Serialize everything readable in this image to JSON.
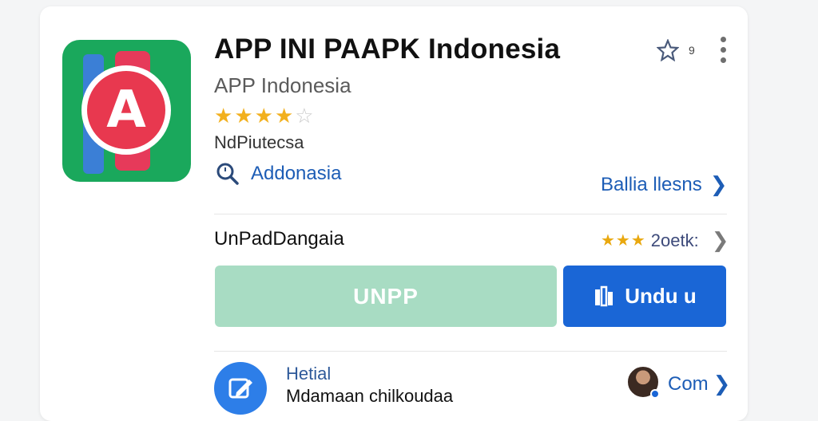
{
  "app": {
    "title": "APP INI PAAPK Indonesia",
    "developer": "APP Indonesia",
    "rating_stars": 4,
    "rating_max": 5,
    "category": "NdPiutecsa",
    "search_label": "Addonasia",
    "right_link": "Ballia llesns",
    "wishlist_count": "9",
    "icon_letter": "A"
  },
  "row2": {
    "label": "UnPadDangaia",
    "mini_stars": "★★★",
    "rating_text": "2oetk:"
  },
  "buttons": {
    "secondary_label": "UNPP",
    "primary_label": "Undu u"
  },
  "bottom": {
    "title": "Hetial",
    "subtitle": "Mdamaan chilkoudaa",
    "link_label": "Com"
  },
  "colors": {
    "primary_blue": "#1a66d6",
    "secondary_green": "#a8dcc3",
    "star_gold": "#f2b01e",
    "icon_green": "#1aa85c",
    "icon_red": "#e8384f"
  },
  "icons": [
    "star-icon",
    "more-vert-icon",
    "search-icon",
    "chevron-right-icon",
    "download-icon",
    "edit-icon"
  ]
}
